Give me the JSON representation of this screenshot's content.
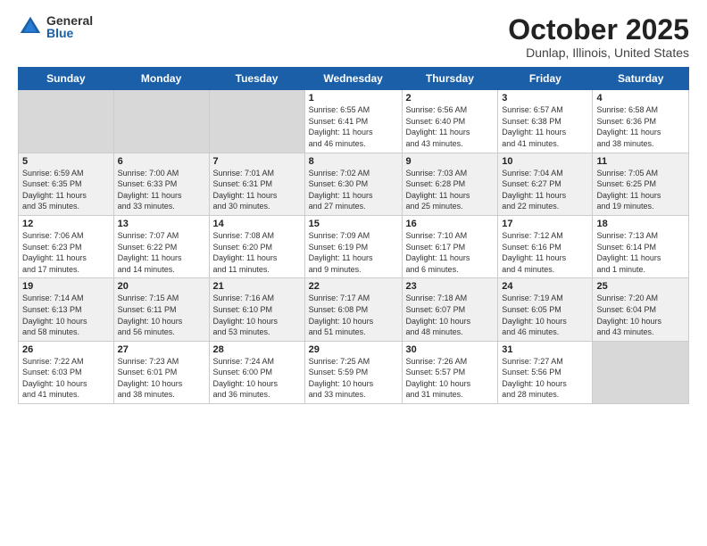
{
  "logo": {
    "general": "General",
    "blue": "Blue"
  },
  "title": "October 2025",
  "subtitle": "Dunlap, Illinois, United States",
  "weekdays": [
    "Sunday",
    "Monday",
    "Tuesday",
    "Wednesday",
    "Thursday",
    "Friday",
    "Saturday"
  ],
  "rows": [
    [
      {
        "num": "",
        "info": ""
      },
      {
        "num": "",
        "info": ""
      },
      {
        "num": "",
        "info": ""
      },
      {
        "num": "1",
        "info": "Sunrise: 6:55 AM\nSunset: 6:41 PM\nDaylight: 11 hours\nand 46 minutes."
      },
      {
        "num": "2",
        "info": "Sunrise: 6:56 AM\nSunset: 6:40 PM\nDaylight: 11 hours\nand 43 minutes."
      },
      {
        "num": "3",
        "info": "Sunrise: 6:57 AM\nSunset: 6:38 PM\nDaylight: 11 hours\nand 41 minutes."
      },
      {
        "num": "4",
        "info": "Sunrise: 6:58 AM\nSunset: 6:36 PM\nDaylight: 11 hours\nand 38 minutes."
      }
    ],
    [
      {
        "num": "5",
        "info": "Sunrise: 6:59 AM\nSunset: 6:35 PM\nDaylight: 11 hours\nand 35 minutes."
      },
      {
        "num": "6",
        "info": "Sunrise: 7:00 AM\nSunset: 6:33 PM\nDaylight: 11 hours\nand 33 minutes."
      },
      {
        "num": "7",
        "info": "Sunrise: 7:01 AM\nSunset: 6:31 PM\nDaylight: 11 hours\nand 30 minutes."
      },
      {
        "num": "8",
        "info": "Sunrise: 7:02 AM\nSunset: 6:30 PM\nDaylight: 11 hours\nand 27 minutes."
      },
      {
        "num": "9",
        "info": "Sunrise: 7:03 AM\nSunset: 6:28 PM\nDaylight: 11 hours\nand 25 minutes."
      },
      {
        "num": "10",
        "info": "Sunrise: 7:04 AM\nSunset: 6:27 PM\nDaylight: 11 hours\nand 22 minutes."
      },
      {
        "num": "11",
        "info": "Sunrise: 7:05 AM\nSunset: 6:25 PM\nDaylight: 11 hours\nand 19 minutes."
      }
    ],
    [
      {
        "num": "12",
        "info": "Sunrise: 7:06 AM\nSunset: 6:23 PM\nDaylight: 11 hours\nand 17 minutes."
      },
      {
        "num": "13",
        "info": "Sunrise: 7:07 AM\nSunset: 6:22 PM\nDaylight: 11 hours\nand 14 minutes."
      },
      {
        "num": "14",
        "info": "Sunrise: 7:08 AM\nSunset: 6:20 PM\nDaylight: 11 hours\nand 11 minutes."
      },
      {
        "num": "15",
        "info": "Sunrise: 7:09 AM\nSunset: 6:19 PM\nDaylight: 11 hours\nand 9 minutes."
      },
      {
        "num": "16",
        "info": "Sunrise: 7:10 AM\nSunset: 6:17 PM\nDaylight: 11 hours\nand 6 minutes."
      },
      {
        "num": "17",
        "info": "Sunrise: 7:12 AM\nSunset: 6:16 PM\nDaylight: 11 hours\nand 4 minutes."
      },
      {
        "num": "18",
        "info": "Sunrise: 7:13 AM\nSunset: 6:14 PM\nDaylight: 11 hours\nand 1 minute."
      }
    ],
    [
      {
        "num": "19",
        "info": "Sunrise: 7:14 AM\nSunset: 6:13 PM\nDaylight: 10 hours\nand 58 minutes."
      },
      {
        "num": "20",
        "info": "Sunrise: 7:15 AM\nSunset: 6:11 PM\nDaylight: 10 hours\nand 56 minutes."
      },
      {
        "num": "21",
        "info": "Sunrise: 7:16 AM\nSunset: 6:10 PM\nDaylight: 10 hours\nand 53 minutes."
      },
      {
        "num": "22",
        "info": "Sunrise: 7:17 AM\nSunset: 6:08 PM\nDaylight: 10 hours\nand 51 minutes."
      },
      {
        "num": "23",
        "info": "Sunrise: 7:18 AM\nSunset: 6:07 PM\nDaylight: 10 hours\nand 48 minutes."
      },
      {
        "num": "24",
        "info": "Sunrise: 7:19 AM\nSunset: 6:05 PM\nDaylight: 10 hours\nand 46 minutes."
      },
      {
        "num": "25",
        "info": "Sunrise: 7:20 AM\nSunset: 6:04 PM\nDaylight: 10 hours\nand 43 minutes."
      }
    ],
    [
      {
        "num": "26",
        "info": "Sunrise: 7:22 AM\nSunset: 6:03 PM\nDaylight: 10 hours\nand 41 minutes."
      },
      {
        "num": "27",
        "info": "Sunrise: 7:23 AM\nSunset: 6:01 PM\nDaylight: 10 hours\nand 38 minutes."
      },
      {
        "num": "28",
        "info": "Sunrise: 7:24 AM\nSunset: 6:00 PM\nDaylight: 10 hours\nand 36 minutes."
      },
      {
        "num": "29",
        "info": "Sunrise: 7:25 AM\nSunset: 5:59 PM\nDaylight: 10 hours\nand 33 minutes."
      },
      {
        "num": "30",
        "info": "Sunrise: 7:26 AM\nSunset: 5:57 PM\nDaylight: 10 hours\nand 31 minutes."
      },
      {
        "num": "31",
        "info": "Sunrise: 7:27 AM\nSunset: 5:56 PM\nDaylight: 10 hours\nand 28 minutes."
      },
      {
        "num": "",
        "info": ""
      }
    ]
  ]
}
